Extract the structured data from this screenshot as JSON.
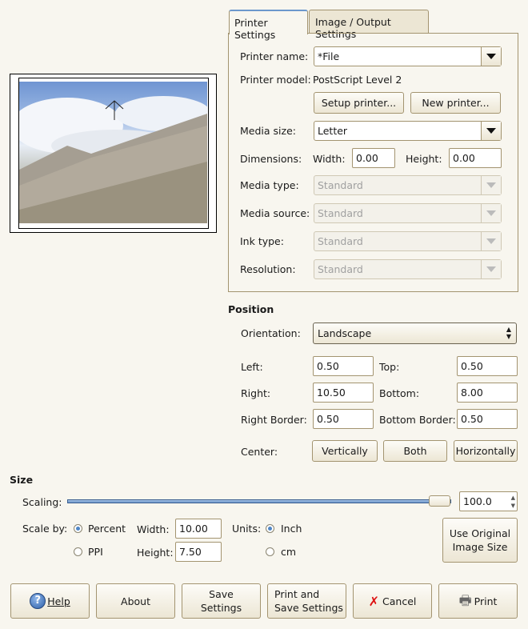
{
  "tabs": [
    {
      "label": "Printer Settings",
      "active": true
    },
    {
      "label": "Image / Output Settings",
      "active": false
    }
  ],
  "printer": {
    "name_label": "Printer name:",
    "name_value": "*File",
    "model_label": "Printer model:",
    "model_value": "PostScript Level 2",
    "setup_button": "Setup printer...",
    "new_button": "New printer...",
    "media_size_label": "Media size:",
    "media_size_value": "Letter",
    "dimensions_label": "Dimensions:",
    "width_label": "Width:",
    "width_value": "0.00",
    "height_label": "Height:",
    "height_value": "0.00",
    "media_type_label": "Media type:",
    "media_type_value": "Standard",
    "media_source_label": "Media source:",
    "media_source_value": "Standard",
    "ink_type_label": "Ink type:",
    "ink_type_value": "Standard",
    "resolution_label": "Resolution:",
    "resolution_value": "Standard"
  },
  "position": {
    "title": "Position",
    "orientation_label": "Orientation:",
    "orientation_value": "Landscape",
    "left_label": "Left:",
    "left_value": "0.50",
    "top_label": "Top:",
    "top_value": "0.50",
    "right_label": "Right:",
    "right_value": "10.50",
    "bottom_label": "Bottom:",
    "bottom_value": "8.00",
    "right_border_label": "Right Border:",
    "right_border_value": "0.50",
    "bottom_border_label": "Bottom Border:",
    "bottom_border_value": "0.50",
    "center_label": "Center:",
    "vertically": "Vertically",
    "both": "Both",
    "horizontally": "Horizontally"
  },
  "size": {
    "title": "Size",
    "scaling_label": "Scaling:",
    "scaling_value": "100.0",
    "scaling_percent": 100,
    "scale_by_label": "Scale by:",
    "percent": "Percent",
    "ppi": "PPI",
    "scale_by_selected": "Percent",
    "width_label": "Width:",
    "width_value": "10.00",
    "height_label": "Height:",
    "height_value": "7.50",
    "units_label": "Units:",
    "inch": "Inch",
    "cm": "cm",
    "units_selected": "Inch",
    "original_line1": "Use Original",
    "original_line2": "Image Size"
  },
  "buttons": {
    "help": "Help",
    "about": "About",
    "save1": "Save",
    "save2": "Settings",
    "ps1": "Print and",
    "ps2": "Save Settings",
    "cancel": "Cancel",
    "print": "Print"
  },
  "colors": {
    "accent": "#4f86c6",
    "tab_active_top": "#6c98cc"
  }
}
